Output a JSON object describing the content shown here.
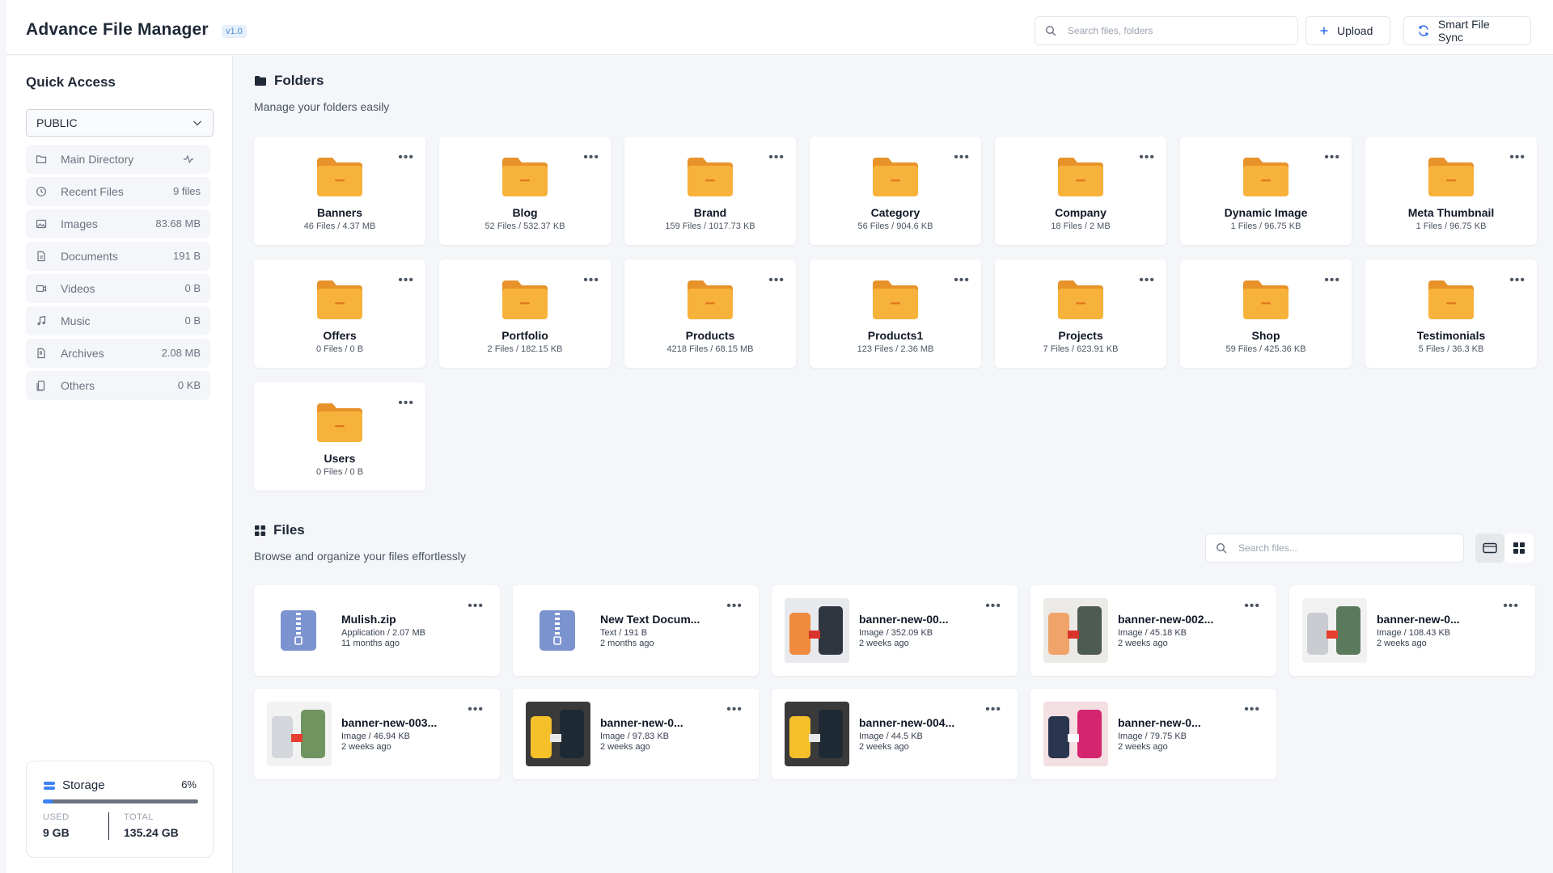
{
  "header": {
    "title": "Advance File Manager",
    "version": "v1.0",
    "search_placeholder": "Search files, folders",
    "upload_label": "Upload",
    "sync_label": "Smart File Sync"
  },
  "sidebar": {
    "title": "Quick Access",
    "select_value": "PUBLIC",
    "items": [
      {
        "label": "Main Directory",
        "value": "",
        "icon": "folder-icon"
      },
      {
        "label": "Recent Files",
        "value": "9 files",
        "icon": "clock-icon"
      },
      {
        "label": "Images",
        "value": "83.68 MB",
        "icon": "image-icon"
      },
      {
        "label": "Documents",
        "value": "191 B",
        "icon": "document-icon"
      },
      {
        "label": "Videos",
        "value": "0 B",
        "icon": "video-icon"
      },
      {
        "label": "Music",
        "value": "0 B",
        "icon": "music-icon"
      },
      {
        "label": "Archives",
        "value": "2.08 MB",
        "icon": "archive-icon"
      },
      {
        "label": "Others",
        "value": "0 KB",
        "icon": "file-icon"
      }
    ],
    "storage": {
      "label": "Storage",
      "percent": "6%",
      "used_caption": "USED",
      "used": "9 GB",
      "total_caption": "TOTAL",
      "total": "135.24 GB"
    }
  },
  "folders_section": {
    "title": "Folders",
    "subtitle": "Manage your folders easily",
    "folders": [
      {
        "name": "Banners",
        "meta": "46 Files / 4.37 MB"
      },
      {
        "name": "Blog",
        "meta": "52 Files / 532.37 KB"
      },
      {
        "name": "Brand",
        "meta": "159 Files / 1017.73 KB"
      },
      {
        "name": "Category",
        "meta": "56 Files / 904.6 KB"
      },
      {
        "name": "Company",
        "meta": "18 Files / 2 MB"
      },
      {
        "name": "Dynamic Image",
        "meta": "1 Files / 96.75 KB"
      },
      {
        "name": "Meta Thumbnail",
        "meta": "1 Files / 96.75 KB"
      },
      {
        "name": "Offers",
        "meta": "0 Files / 0 B"
      },
      {
        "name": "Portfolio",
        "meta": "2 Files / 182.15 KB"
      },
      {
        "name": "Products",
        "meta": "4218 Files / 68.15 MB"
      },
      {
        "name": "Products1",
        "meta": "123 Files / 2.36 MB"
      },
      {
        "name": "Projects",
        "meta": "7 Files / 623.91 KB"
      },
      {
        "name": "Shop",
        "meta": "59 Files / 425.36 KB"
      },
      {
        "name": "Testimonials",
        "meta": "5 Files / 36.3 KB"
      },
      {
        "name": "Users",
        "meta": "0 Files / 0 B"
      }
    ]
  },
  "files_section": {
    "title": "Files",
    "subtitle": "Browse and organize your files effortlessly",
    "search_placeholder": "Search files...",
    "files": [
      {
        "name": "Mulish.zip",
        "meta": "Application / 2.07 MB",
        "age": "11 months ago",
        "kind": "zip"
      },
      {
        "name": "New Text Docum...",
        "meta": "Text / 191 B",
        "age": "2 months ago",
        "kind": "zip"
      },
      {
        "name": "banner-new-00...",
        "meta": "Image / 352.09 KB",
        "age": "2 weeks ago",
        "kind": "image"
      },
      {
        "name": "banner-new-002...",
        "meta": "Image / 45.18 KB",
        "age": "2 weeks ago",
        "kind": "image"
      },
      {
        "name": "banner-new-0...",
        "meta": "Image / 108.43 KB",
        "age": "2 weeks ago",
        "kind": "image"
      },
      {
        "name": "banner-new-003...",
        "meta": "Image / 46.94 KB",
        "age": "2 weeks ago",
        "kind": "image"
      },
      {
        "name": "banner-new-0...",
        "meta": "Image / 97.83 KB",
        "age": "2 weeks ago",
        "kind": "image"
      },
      {
        "name": "banner-new-004...",
        "meta": "Image / 44.5 KB",
        "age": "2 weeks ago",
        "kind": "image"
      },
      {
        "name": "banner-new-0...",
        "meta": "Image / 79.75 KB",
        "age": "2 weeks ago",
        "kind": "image"
      }
    ]
  }
}
